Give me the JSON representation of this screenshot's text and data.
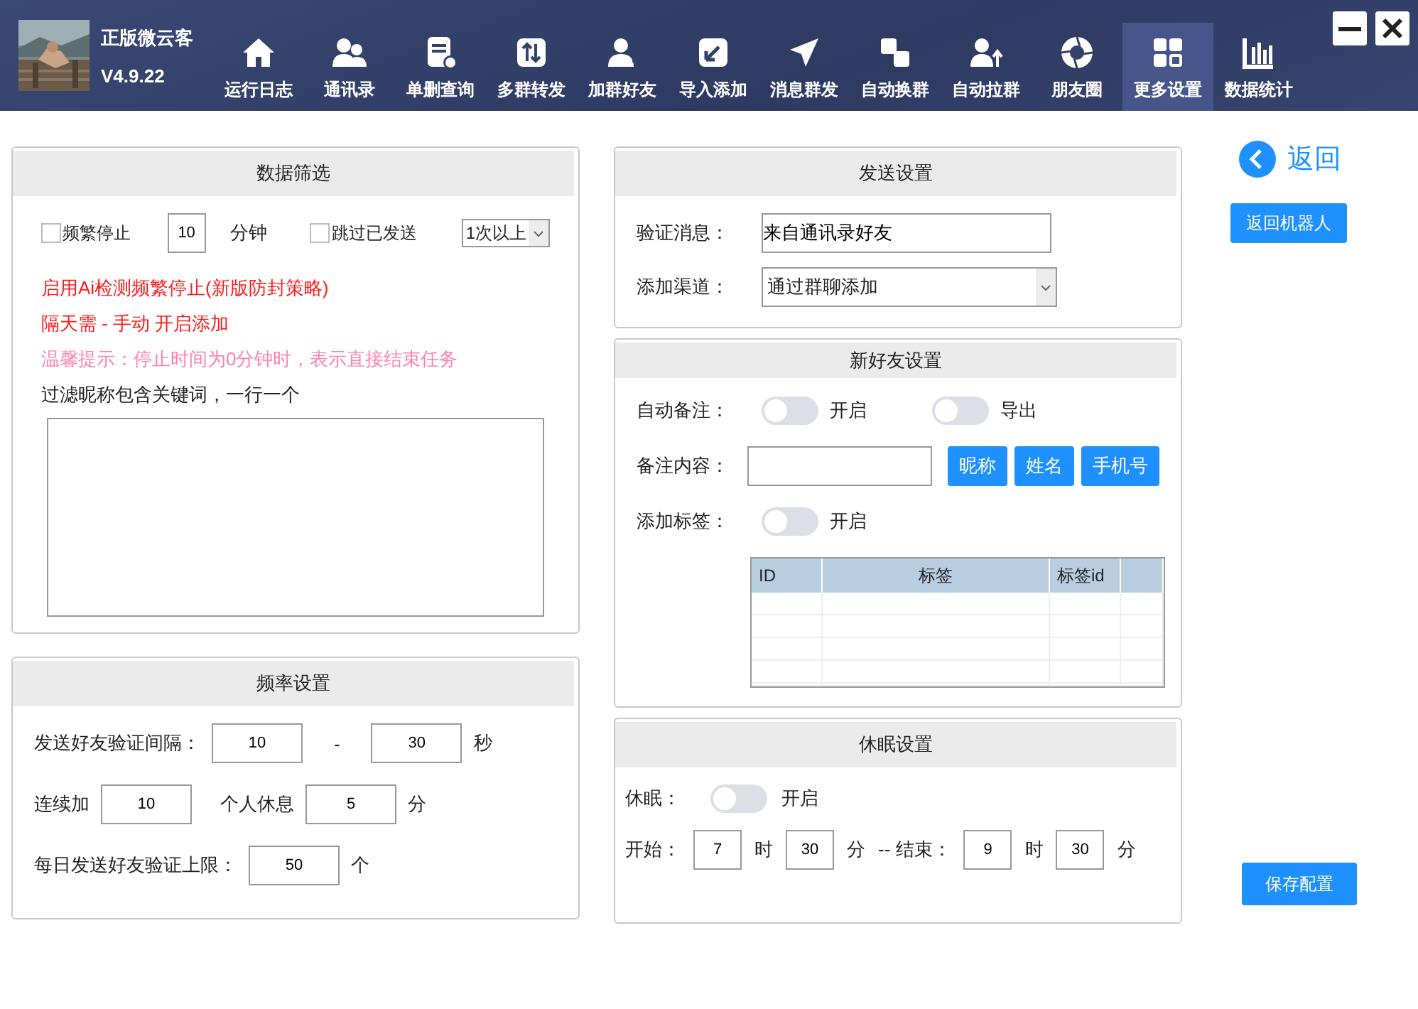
{
  "header": {
    "app_name": "正版微云客",
    "version": "V4.9.22",
    "nav": [
      {
        "label": "运行日志",
        "selected": false
      },
      {
        "label": "通讯录",
        "selected": false
      },
      {
        "label": "单删查询",
        "selected": false
      },
      {
        "label": "多群转发",
        "selected": false
      },
      {
        "label": "加群好友",
        "selected": false
      },
      {
        "label": "导入添加",
        "selected": false
      },
      {
        "label": "消息群发",
        "selected": false
      },
      {
        "label": "自动换群",
        "selected": false
      },
      {
        "label": "自动拉群",
        "selected": false
      },
      {
        "label": "朋友圈",
        "selected": false
      },
      {
        "label": "更多设置",
        "selected": true
      },
      {
        "label": "数据统计",
        "selected": false
      }
    ]
  },
  "filter": {
    "title": "数据筛选",
    "freq_stop": {
      "label": "频繁停止",
      "checked": false
    },
    "minutes": "10",
    "minutes_unit": "分钟",
    "skip_sent": {
      "label": "跳过已发送",
      "checked": false
    },
    "times": "1次以上",
    "notes": [
      {
        "kind": "warning",
        "text": "启用Ai检测频繁停止(新版防封策略)"
      },
      {
        "kind": "warning",
        "text": "隔天需 - 手动 开启添加"
      },
      {
        "kind": "hint",
        "text": "温馨提示：停止时间为0分钟时，表示直接结束任务"
      },
      {
        "kind": "label",
        "text": "过滤昵称包含关键词，一行一个"
      }
    ]
  },
  "rate": {
    "title": "频率设置",
    "interval_label": "发送好友验证间隔：",
    "interval_min": "10",
    "dash": "-",
    "interval_max": "30",
    "interval_unit": "秒",
    "batch_prefix": "连续加",
    "batch_count": "10",
    "batch_middle": "个人休息",
    "rest": "5",
    "rest_unit": "分",
    "daily_label": "每日发送好友验证上限：",
    "daily": "50",
    "daily_unit": "个"
  },
  "send": {
    "title": "发送设置",
    "verify_label": "验证消息：",
    "verify_value": "来自通讯录好友",
    "channel_label": "添加渠道：",
    "channel_value": "通过群聊添加"
  },
  "new_friend": {
    "title": "新好友设置",
    "auto_remark_label": "自动备注：",
    "switches": [
      {
        "label": "开启",
        "on": false
      },
      {
        "label": "导出",
        "on": false
      }
    ],
    "remark_label": "备注内容：",
    "buttons": [
      "昵称",
      "姓名",
      "手机号"
    ],
    "tag_label": "添加标签：",
    "tag_switch": {
      "label": "开启",
      "on": false
    },
    "table": {
      "columns": [
        "ID",
        "标签",
        "标签id"
      ]
    }
  },
  "sleep": {
    "title": "休眠设置",
    "label": "休眠：",
    "switch": {
      "label": "开启",
      "on": false
    },
    "start_label": "开始：",
    "start_hour": "7",
    "hour_unit": "时",
    "start_minute": "30",
    "minute_unit": "分",
    "end_label": "-- 结束：",
    "end_hour": "9",
    "end_hour_unit": "时",
    "end_minute": "30",
    "end_minute_unit": "分"
  },
  "side": {
    "back": "返回",
    "back_robot": "返回机器人",
    "save": "保存配置"
  }
}
